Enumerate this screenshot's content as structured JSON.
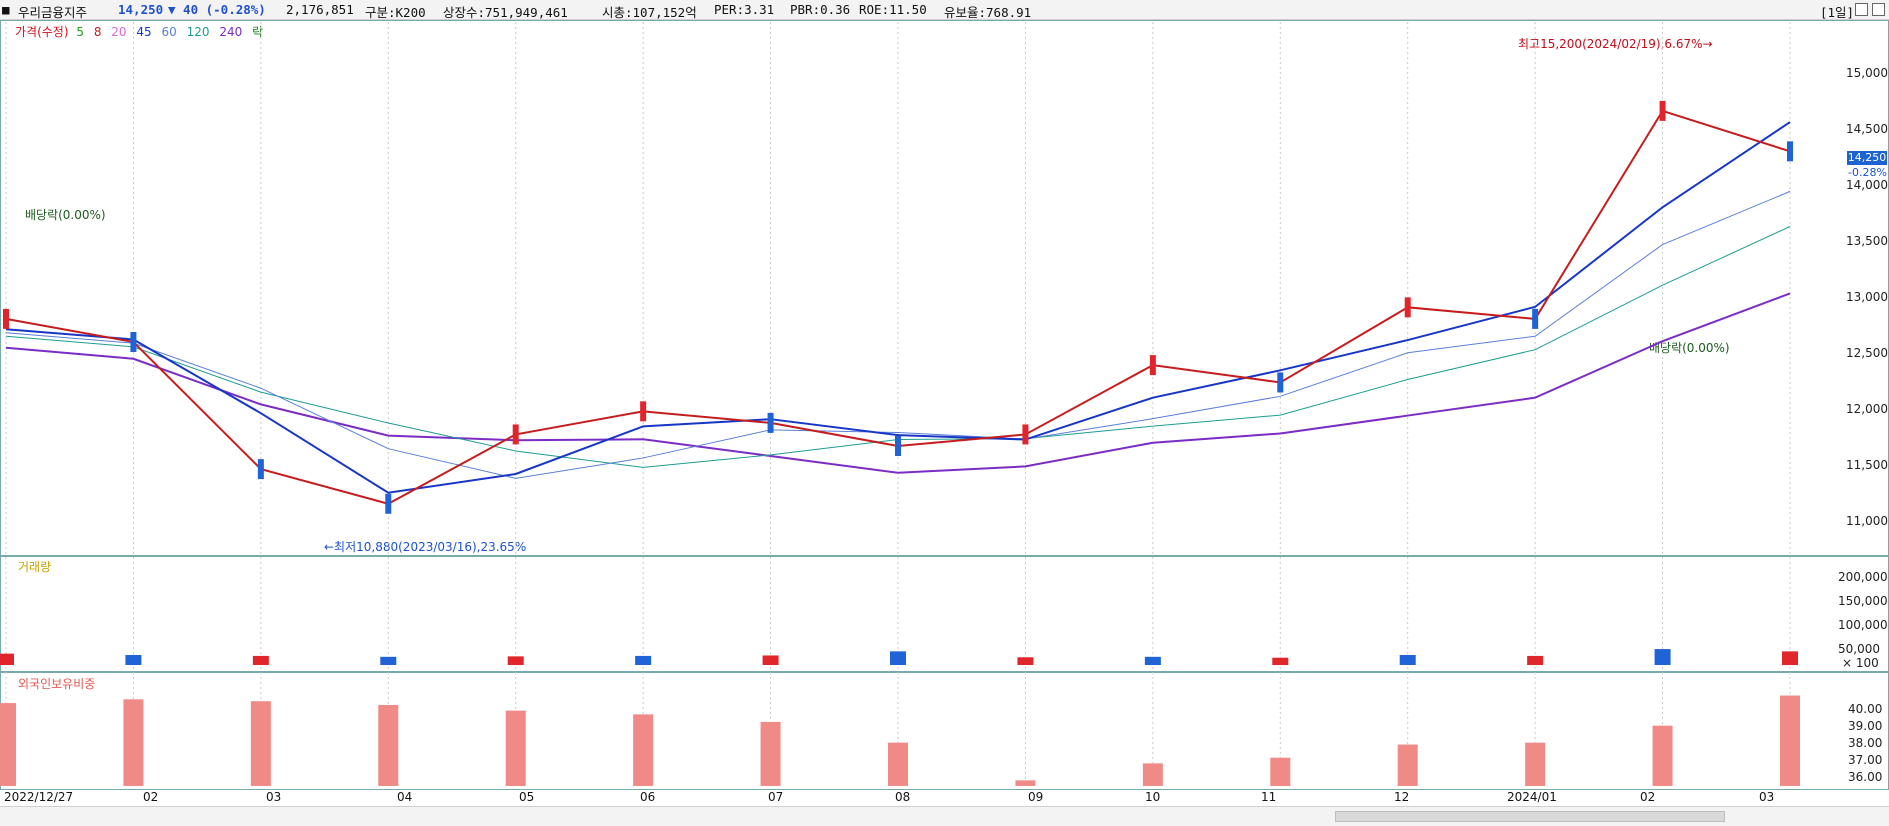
{
  "header": {
    "stock_name": "우리금융지주",
    "price": "14,250",
    "change": "▼ 40 (-0.28%)",
    "volume": "2,176,851",
    "category": "구분:K200",
    "listed_shares": "상장수:751,949,461",
    "market_cap": "시총:107,152억",
    "per": "PER:3.31",
    "pbr": "PBR:0.36",
    "roe": "ROE:11.50",
    "retention": "유보율:768.91",
    "period_label": "[1일]"
  },
  "legend": {
    "price_label": "가격(수정)",
    "ma": [
      "5",
      "8",
      "20",
      "45",
      "60",
      "120",
      "240"
    ],
    "rak": "락"
  },
  "panels": {
    "volume_title": "거래량",
    "foreign_title": "외국인보유비중"
  },
  "annotations": {
    "dividend1": "배당락(0.00%)",
    "low": "←최저10,880(2023/03/16),23.65%",
    "high": "최고15,200(2024/02/19),6.67%→",
    "dividend2": "배당락(0.00%)"
  },
  "price_axis": {
    "ticks": [
      "15,000",
      "14,500",
      "14,000",
      "13,500",
      "13,000",
      "12,500",
      "12,000",
      "11,500",
      "11,000"
    ],
    "last_price_tag": "14,250",
    "last_change_tag": "-0.28%"
  },
  "volume_axis": {
    "ticks": [
      "200,000",
      "150,000",
      "100,000",
      "50,000",
      "× 100"
    ]
  },
  "foreign_axis": {
    "ticks": [
      "40.00",
      "39.00",
      "38.00",
      "37.00",
      "36.00"
    ]
  },
  "xaxis": {
    "labels": [
      "2022/12/27",
      "02",
      "03",
      "04",
      "05",
      "06",
      "07",
      "08",
      "09",
      "10",
      "11",
      "12",
      "2024/01",
      "02",
      "03"
    ]
  },
  "chart_data": [
    {
      "type": "line",
      "title": "",
      "xlabel": "",
      "ylabel": "",
      "ylim": [
        10800,
        15300
      ],
      "x": [
        "2022/12/27",
        "2023/02",
        "2023/03",
        "2023/04",
        "2023/05",
        "2023/06",
        "2023/07",
        "2023/08",
        "2023/09",
        "2023/10",
        "2023/11",
        "2023/12",
        "2024/01",
        "2024/02",
        "2024/03"
      ],
      "series": [
        {
          "name": "가격(수정)",
          "values": [
            12800,
            12600,
            11500,
            11200,
            11800,
            12000,
            11900,
            11700,
            11800,
            12400,
            12250,
            12900,
            12800,
            14600,
            14250
          ]
        }
      ]
    },
    {
      "type": "bar",
      "title": "",
      "xlabel": "",
      "ylabel": "",
      "ylim": [
        0,
        220000
      ],
      "categories": [
        "2022/12/27",
        "2023/02",
        "2023/03",
        "2023/04",
        "2023/05",
        "2023/06",
        "2023/07",
        "2023/08",
        "2023/09",
        "2023/10",
        "2023/11",
        "2023/12",
        "2024/01",
        "2024/02",
        "2024/03"
      ],
      "series": [
        {
          "name": "거래량",
          "values": [
            25000,
            22000,
            20000,
            18000,
            19000,
            20000,
            21000,
            30000,
            17000,
            18000,
            16000,
            22000,
            20000,
            35000,
            30000
          ]
        }
      ]
    },
    {
      "type": "bar",
      "title": "",
      "xlabel": "",
      "ylabel": "",
      "ylim": [
        35.6,
        40.8
      ],
      "categories": [
        "2022/12/27",
        "2023/02",
        "2023/03",
        "2023/04",
        "2023/05",
        "2023/06",
        "2023/07",
        "2023/08",
        "2023/09",
        "2023/10",
        "2023/11",
        "2023/12",
        "2024/01",
        "2024/02",
        "2024/03"
      ],
      "series": [
        {
          "name": "외국인보유비중",
          "values": [
            40.0,
            40.2,
            40.1,
            39.9,
            39.6,
            39.4,
            39.0,
            37.9,
            35.9,
            36.8,
            37.1,
            37.8,
            37.9,
            38.8,
            40.4
          ]
        }
      ]
    }
  ],
  "colors": {
    "up": "#e0262a",
    "down": "#1f63d6",
    "ma240": "#7b2cc5",
    "ma120": "#1c9d8e",
    "ma60": "#5a7fd7",
    "ma45": "#1736c6",
    "ma20": "#d86ad2",
    "ma8": "#c51d1d",
    "ma5": "#1aa51a",
    "foreign_fill": "#f08a86"
  }
}
